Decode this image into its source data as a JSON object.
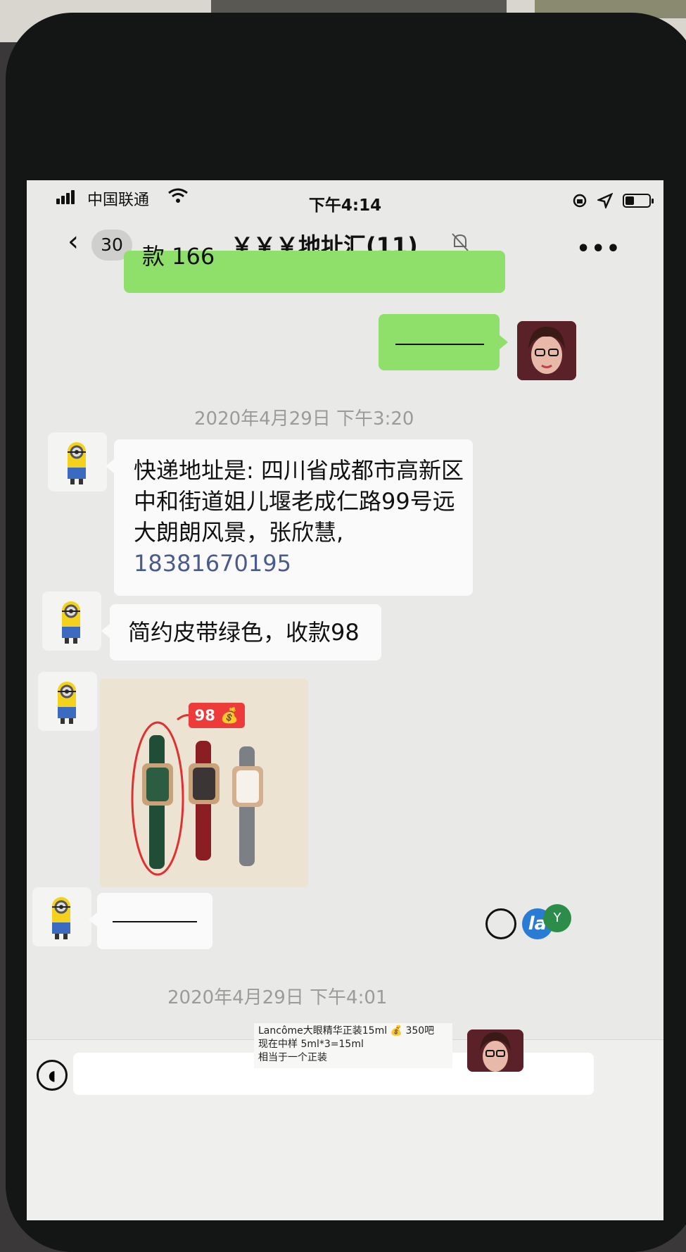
{
  "status_bar": {
    "carrier": "中国联通",
    "time": "下午4:14"
  },
  "nav": {
    "unread_count": "30",
    "title": "￥￥￥地址汇(11)",
    "back_icon": "chevron-left-icon",
    "mute_icon": "bell-slash-icon",
    "more_icon": "ellipsis-icon"
  },
  "messages": {
    "partial_top_text": "款 166",
    "timestamp_1": "2020年4月29日 下午3:20",
    "address_line_1": "快递地址是: 四川省成都市高新区",
    "address_line_2": "中和街道姐儿堰老成仁路99号远",
    "address_line_3": "大朗朗风景，张欣慧,",
    "phone_link": "18381670195",
    "product_msg": "简约皮带绿色，收款98",
    "price_tag": "98 💰",
    "timestamp_2": "2020年4月29日 下午4:01"
  },
  "notice": {
    "line_1": "Lancôme大眼精华正装15ml 💰 350吧",
    "line_2": "现在中样 5ml*3=15ml",
    "line_3": "相当于一个正装"
  },
  "input_bar": {
    "voice_icon": "voice-icon",
    "emoji_icon": "emoji-icon"
  },
  "colors": {
    "own_bubble": "#8fe06a",
    "other_bubble": "#fafafa",
    "price_tag": "#ec3b3a",
    "phone_link": "#4a5a8c"
  }
}
